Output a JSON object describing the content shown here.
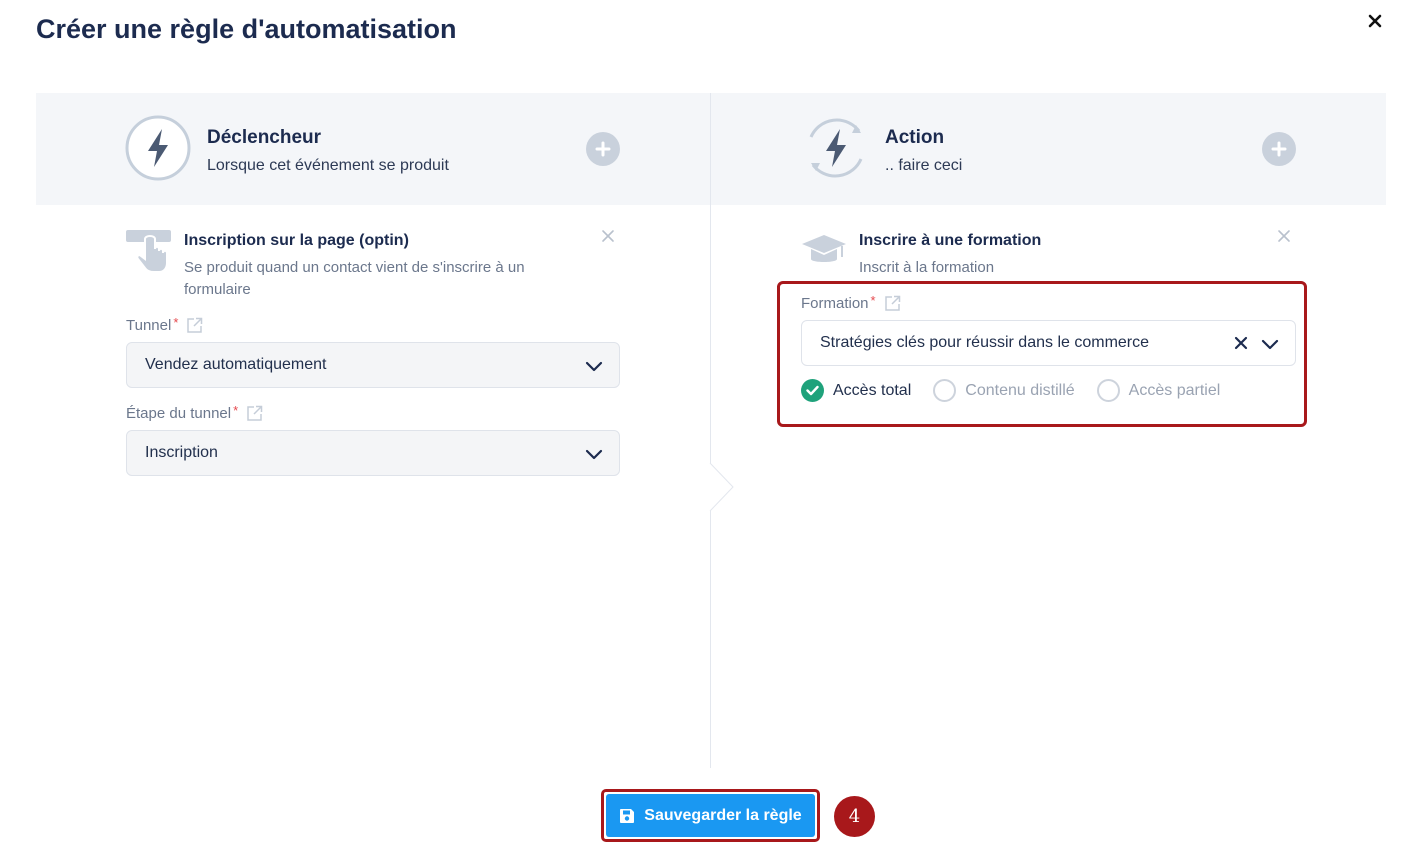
{
  "modal": {
    "title": "Créer une règle d'automatisation"
  },
  "trigger": {
    "title": "Déclencheur",
    "subtitle": "Lorsque cet événement se produit",
    "card": {
      "title": "Inscription sur la page (optin)",
      "description": "Se produit quand un contact vient de s'inscrire à un formulaire"
    },
    "fields": [
      {
        "label": "Tunnel",
        "required": "*",
        "value": "Vendez automatiquement"
      },
      {
        "label": "Étape du tunnel",
        "required": "*",
        "value": "Inscription"
      }
    ]
  },
  "action": {
    "title": "Action",
    "subtitle": ".. faire ceci",
    "card": {
      "title": "Inscrire à une formation",
      "description": "Inscrit à la formation"
    },
    "field": {
      "label": "Formation",
      "required": "*",
      "value": "Stratégies clés pour réussir dans le commerce"
    },
    "access_options": [
      {
        "label": "Accès total",
        "selected": true
      },
      {
        "label": "Contenu distillé",
        "selected": false
      },
      {
        "label": "Accès partiel",
        "selected": false
      }
    ]
  },
  "footer": {
    "save_label": "Sauvegarder la règle",
    "step_number": "4"
  },
  "colors": {
    "primary": "#1a98f2",
    "highlight": "#a8181b",
    "success": "#1fa27b",
    "title": "#1c2b4f"
  },
  "icons": [
    "close-icon",
    "lightning-icon",
    "plus-icon",
    "pointer-hand-icon",
    "graduation-cap-icon",
    "external-link-icon",
    "chevron-down-icon",
    "clear-icon",
    "check-icon",
    "floppy-disk-icon"
  ]
}
